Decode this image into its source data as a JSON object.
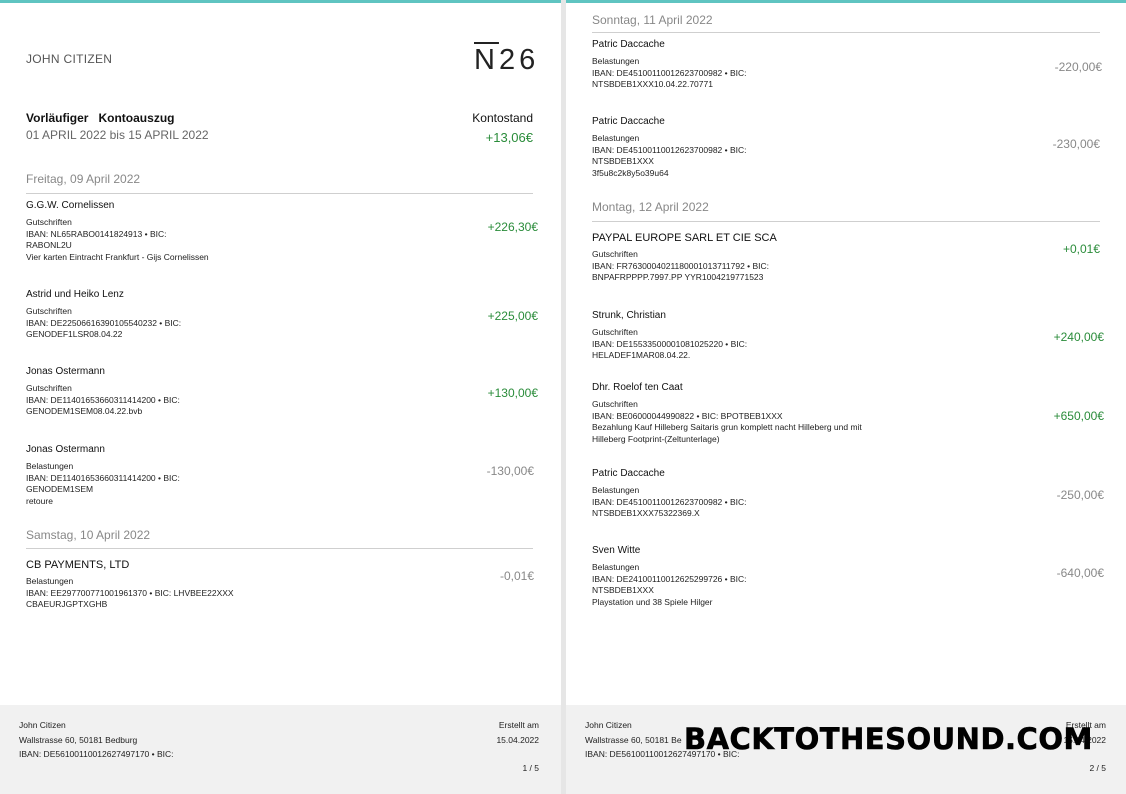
{
  "header": {
    "owner": "JOHN CITIZEN",
    "logo_n": "N",
    "logo_num": "26",
    "title_a": "Vorläufiger",
    "title_b": "Kontoauszug",
    "period": "01 APRIL 2022 bis 15 APRIL 2022",
    "balance_label": "Kontostand",
    "balance": "+13,06€"
  },
  "page1": {
    "days": [
      "Freitag, 09 April 2022",
      "Samstag, 10 April 2022"
    ],
    "tx": [
      {
        "name": "G.G.W. Cornelissen",
        "type": "Gutschriften",
        "l1": "IBAN: NL65RABO0141824913 • BIC:",
        "l2": "RABONL2U",
        "l3": "Vier karten Eintracht Frankfurt - Gijs Cornelissen",
        "amount": "+226,30€"
      },
      {
        "name": "Astrid und Heiko Lenz",
        "type": "Gutschriften",
        "l1": "IBAN: DE22506616390105540232 • BIC:",
        "l2": "GENODEF1LSR08.04.22",
        "amount": "+225,00€"
      },
      {
        "name": "Jonas Ostermann",
        "type": "Gutschriften",
        "l1": "IBAN: DE11401653660311414200 • BIC:",
        "l2": "GENODEM1SEM08.04.22.bvb",
        "amount": "+130,00€"
      },
      {
        "name": "Jonas Ostermann",
        "type": "Belastungen",
        "l1": "IBAN: DE11401653660311414200 • BIC:",
        "l2": "GENODEM1SEM",
        "l3": "retoure",
        "amount": "-130,00€"
      },
      {
        "name": "CB PAYMENTS, LTD",
        "type": "Belastungen",
        "l1": "IBAN: EE297700771001961370 • BIC: LHVBEE22XXX",
        "l2": "CBAEURJGPTXGHB",
        "amount": "-0,01€"
      }
    ]
  },
  "page2": {
    "days": [
      "Sonntag, 11 April 2022",
      "Montag, 12 April 2022"
    ],
    "tx": [
      {
        "name": "Patric Daccache",
        "type": "Belastungen",
        "l1": "IBAN: DE45100110012623700982 • BIC:",
        "l2": "NTSBDEB1XXX10.04.22.70771",
        "amount": "-220,00€"
      },
      {
        "name": "Patric Daccache",
        "type": "Belastungen",
        "l1": "IBAN: DE45100110012623700982 • BIC:",
        "l2": "NTSBDEB1XXX",
        "l3": "3f5u8c2k8y5o39u64",
        "amount": "-230,00€"
      },
      {
        "name": "PAYPAL EUROPE SARL ET CIE SCA",
        "type": "Gutschriften",
        "l1": "IBAN: FR7630004021180001013711792 • BIC:",
        "l2": "BNPAFRPPPP.7997.PP YYR1004219771523",
        "amount": "+0,01€"
      },
      {
        "name": "Strunk, Christian",
        "type": "Gutschriften",
        "l1": "IBAN: DE15533500001081025220 • BIC:",
        "l2": "HELADEF1MAR08.04.22.",
        "amount": "+240,00€"
      },
      {
        "name": "Dhr. Roelof ten Caat",
        "type": "Gutschriften",
        "l1": "IBAN: BE06000044990822 • BIC: BPOTBEB1XXX",
        "l2": "Bezahlung Kauf Hilleberg Saitaris grun komplett nacht Hilleberg und mit",
        "l3": "Hilleberg Footprint-(Zeltunterlage)",
        "amount": "+650,00€"
      },
      {
        "name": "Patric Daccache",
        "type": "Belastungen",
        "l1": "IBAN: DE45100110012623700982 • BIC:",
        "l2": "NTSBDEB1XXX75322369.X",
        "amount": "-250,00€"
      },
      {
        "name": "Sven Witte",
        "type": "Belastungen",
        "l1": "IBAN: DE24100110012625299726 • BIC:",
        "l2": "NTSBDEB1XXX",
        "l3": "Playstation und 38 Spiele Hilger",
        "amount": "-640,00€"
      }
    ]
  },
  "footer": {
    "name": "John Citizen",
    "address": "Wallstrasse 60, 50181 Bedburg",
    "address_p2": "Wallstrasse 60, 50181 Be",
    "iban": "IBAN: DE56100110012627497170 • BIC:",
    "created_label": "Erstellt am",
    "date": "15.04.2022",
    "page1": "1 / 5",
    "page2": "2 / 5"
  },
  "watermark": "BACKTOTHESOUND.COM",
  "colors": {
    "positive": "#2a8c3a",
    "negative": "#888888",
    "accent": "#5fc4c1"
  }
}
